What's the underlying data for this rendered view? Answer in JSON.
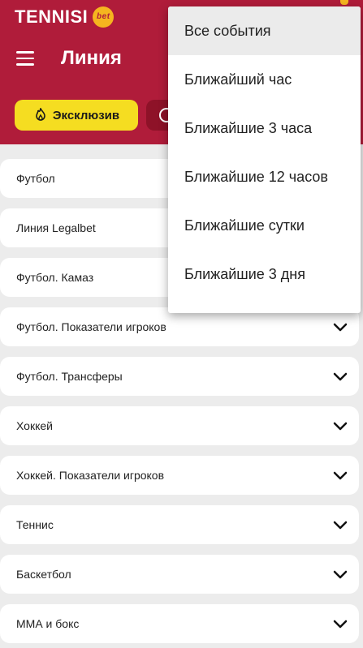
{
  "header": {
    "logo_text": "TENNISI",
    "logo_badge": "bet",
    "title": "Линия",
    "accent_color": "#b01c3a"
  },
  "chips": {
    "exclusive_label": "Эксклюзив",
    "exclusive_icon": "flame-icon",
    "second_icon": "ball-icon"
  },
  "sports": [
    {
      "label": "Футбол"
    },
    {
      "label": "Линия Legalbet"
    },
    {
      "label": "Футбол. Камаз"
    },
    {
      "label": "Футбол. Показатели игроков"
    },
    {
      "label": "Футбол. Трансферы"
    },
    {
      "label": "Хоккей"
    },
    {
      "label": "Хоккей. Показатели игроков"
    },
    {
      "label": "Теннис"
    },
    {
      "label": "Баскетбол"
    },
    {
      "label": "ММА и бокс"
    }
  ],
  "dropdown": {
    "selected": "Все события",
    "items": [
      {
        "label": "Все события"
      },
      {
        "label": "Ближайший час"
      },
      {
        "label": "Ближайшие 3 часа"
      },
      {
        "label": "Ближайшие 12 часов"
      },
      {
        "label": "Ближайшие сутки"
      },
      {
        "label": "Ближайшие 3 дня"
      }
    ]
  }
}
